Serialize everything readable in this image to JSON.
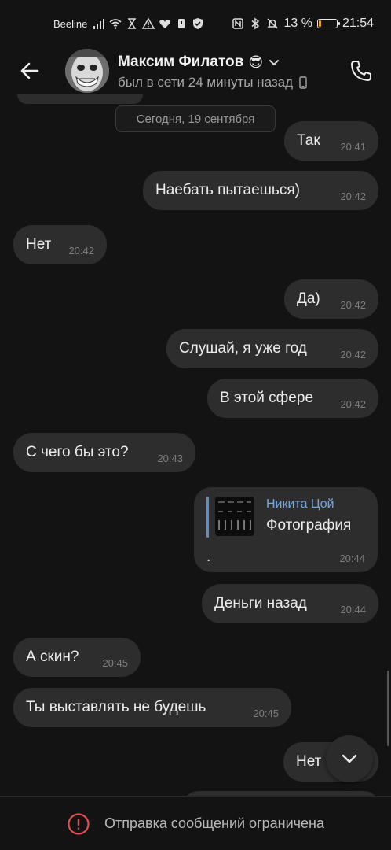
{
  "status_bar": {
    "carrier": "Beeline",
    "battery_percent": "13 %",
    "battery_level": 0.13,
    "time": "21:54",
    "icons": [
      "signal-icon",
      "wifi-icon",
      "hourglass-icon",
      "warning-icon",
      "health-icon",
      "sim-icon",
      "shield-icon",
      "nfc-icon",
      "bluetooth-icon",
      "mute-icon",
      "battery-icon"
    ]
  },
  "header": {
    "contact_name": "Максим Филатов",
    "emoji": "😎",
    "status": "был в сети 24 минуты назад",
    "icons": [
      "back-arrow-icon",
      "chevron-down-icon",
      "phone-device-icon",
      "phone-call-icon"
    ]
  },
  "chat": {
    "date_separator": "Сегодня, 19 сентября",
    "messages": [
      {
        "side": "out",
        "text": "Так",
        "time": "20:41"
      },
      {
        "side": "out",
        "text": "Наебать пытаешься)",
        "time": "20:42"
      },
      {
        "side": "in",
        "text": "Нет",
        "time": "20:42"
      },
      {
        "side": "out",
        "text": "Да)",
        "time": "20:42"
      },
      {
        "side": "out",
        "text": "Слушай, я уже год",
        "time": "20:42"
      },
      {
        "side": "out",
        "text": "В этой сфере",
        "time": "20:42"
      },
      {
        "side": "in",
        "text": "С чего бы это?",
        "time": "20:43"
      },
      {
        "side": "out",
        "text": "Деньги назад",
        "time": "20:44"
      },
      {
        "side": "in",
        "text": "А скин?",
        "time": "20:45"
      },
      {
        "side": "in",
        "text": "Ты выставлять не будешь",
        "time": "20:45"
      },
      {
        "side": "out",
        "text": "Нет",
        "time": ""
      }
    ],
    "reply_message": {
      "author": "Никита Цой",
      "type": "Фотография",
      "text": ".",
      "time": "20:44"
    }
  },
  "footer": {
    "text": "Отправка сообщений ограничена",
    "icon": "error-circle-icon",
    "accent_color": "#e05050"
  },
  "colors": {
    "background": "#131313",
    "bubble": "#2d2d2d",
    "reply_author": "#71a9e8",
    "reply_bar": "#5a8fd0"
  }
}
